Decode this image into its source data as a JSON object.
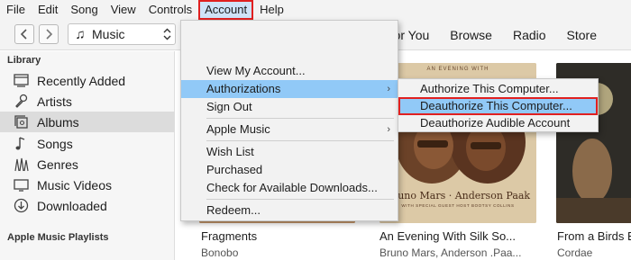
{
  "menubar": {
    "items": [
      "File",
      "Edit",
      "Song",
      "View",
      "Controls",
      "Account",
      "Help"
    ],
    "active": "Account"
  },
  "toolbar": {
    "media_picker": "Music",
    "tabs": [
      "For You",
      "Browse",
      "Radio",
      "Store"
    ]
  },
  "sidebar": {
    "library_title": "Library",
    "items": [
      {
        "label": "Recently Added",
        "icon": "recently-added-icon"
      },
      {
        "label": "Artists",
        "icon": "microphone-icon"
      },
      {
        "label": "Albums",
        "icon": "album-stack-icon"
      },
      {
        "label": "Songs",
        "icon": "music-note-icon"
      },
      {
        "label": "Genres",
        "icon": "genres-icon"
      },
      {
        "label": "Music Videos",
        "icon": "video-icon"
      },
      {
        "label": "Downloaded",
        "icon": "download-icon"
      }
    ],
    "selected": "Albums",
    "playlists_title": "Apple Music Playlists"
  },
  "account_menu": {
    "items": [
      "View My Account...",
      "Authorizations",
      "Sign Out",
      "Apple Music",
      "Wish List",
      "Purchased",
      "Check for Available Downloads...",
      "Redeem..."
    ],
    "highlighted": "Authorizations"
  },
  "authorizations_submenu": {
    "items": [
      "Authorize This Computer...",
      "Deauthorize This Computer...",
      "Deauthorize Audible Account"
    ],
    "highlighted": "Deauthorize This Computer..."
  },
  "albums": [
    {
      "title": "Fragments",
      "artist": "Bonobo"
    },
    {
      "title": "An Evening With Silk So...",
      "artist": "Bruno Mars, Anderson .Paa...",
      "cover": {
        "top": "AN EVENING WITH",
        "names": "Bruno Mars · Anderson Paak",
        "sub": "WITH SPECIAL GUEST HOST BOOTSY COLLINS"
      }
    },
    {
      "title": "From a Birds E",
      "artist": "Cordae"
    }
  ],
  "colors": {
    "menu_highlight": "#91c9f7",
    "callout_red": "#e02020",
    "sidebar_selected": "#dcdcdc"
  }
}
